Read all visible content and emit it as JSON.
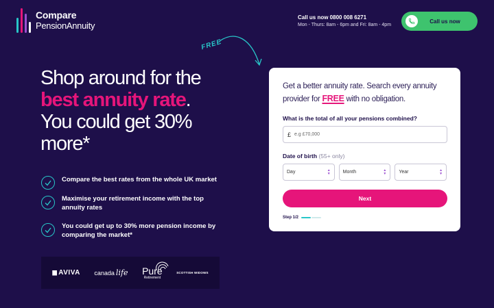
{
  "header": {
    "logo_line1": "Compare",
    "logo_line2": "PensionAnnuity",
    "call_line1": "Call us now 0800 008 6271",
    "call_line2": "Mon - Thurs: 8am - 6pm and Fri: 8am - 4pm",
    "call_button": "Call us now"
  },
  "free_tag": "FREE",
  "hero": {
    "line1": "Shop around for the",
    "accent": "best annuity rate",
    "period": ".",
    "line3": "You could get 30%",
    "line4": "more*"
  },
  "benefits": [
    "Compare the best rates from the whole UK market",
    "Maximise your retirement income with the top annuity rates",
    "You could get up to 30% more pension income by comparing the market*"
  ],
  "partners": {
    "aviva": "AVIVA",
    "canada": "canada",
    "canada_life": "life",
    "pure": "Pure",
    "pure_sub": "Retirement",
    "scottish": "SCOTTISH WIDOWS"
  },
  "form": {
    "intro_start": "Get a better annuity rate. Search every annuity provider for ",
    "intro_free": "FREE",
    "intro_end": " with no obligation.",
    "pension_label": "What is the total of all your pensions combined?",
    "pension_prefix": "£",
    "pension_placeholder": "e.g £70,000",
    "dob_label": "Date of birth",
    "dob_hint": "(55+ only)",
    "day": "Day",
    "month": "Month",
    "year": "Year",
    "next": "Next",
    "step": "Step 1/2"
  },
  "progress": {
    "current_step": 1,
    "total_steps": 2
  },
  "colors": {
    "background": "#1e0f4a",
    "accent_pink": "#e6157a",
    "accent_teal": "#28c6c8",
    "call_green": "#3ec36e"
  },
  "icons": {
    "logo": "bar-chart-logo-icon",
    "phone": "phone-icon",
    "check": "check-circle-icon",
    "arrow": "curved-arrow-icon"
  }
}
